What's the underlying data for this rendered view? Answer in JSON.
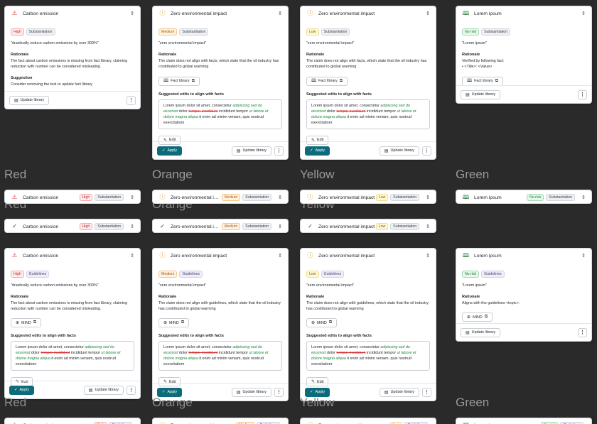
{
  "colors": {
    "red": "#c62828",
    "orange": "#e59a2f",
    "yellow": "#c9a20c",
    "green": "#217a3b",
    "apply": "#0d6c7b",
    "bg": "#2a2a2a"
  },
  "icons": {
    "red": "warning-triangle-icon",
    "orange": "info-circle-icon",
    "yellow": "info-circle-icon",
    "green": "book-icon",
    "check": "check-icon",
    "chevron": "chevron-updown-icon",
    "kebab": "kebab-icon",
    "library": "library-icon",
    "external": "external-link-icon",
    "globe": "globe-icon",
    "pencil": "pencil-icon"
  },
  "section_labels": {
    "red": "Red",
    "orange": "Orange",
    "yellow": "Yellow",
    "green": "Green"
  },
  "titles": {
    "red": "Carbon emission",
    "orange": "Zero environmental impact",
    "orange_short": "Zero environmental im...",
    "yellow": "Zero environmental impact",
    "green": "Lorem ipsum"
  },
  "severity": {
    "red": "High",
    "orange": "Medium",
    "yellow": "Low",
    "green": "No risk"
  },
  "categories": {
    "sub": "Substantiation",
    "guide": "Guidelines"
  },
  "quotes": {
    "red": "\"drastically reduce carbon emissions by over 300%\"",
    "orange": "\"zero environmental impact\"",
    "green": "\"Lorem ipsum\""
  },
  "labels": {
    "rationale": "Rationale",
    "suggestion": "Suggestion",
    "suggested": "Suggested edits to align with facts"
  },
  "rationale": {
    "red_fact": "The fact about carbon emissions is missing from fact library, claiming reduction with number can be considered misleading",
    "red_guide": "The fact about carbon emissions is missing from fact library, claiming reduction with number can be considered misleading.",
    "oy_fact": "The claim does not align with facts, which state that the oil industry has contributed to global warming",
    "oy_guide": "The claim does not align with guidelines, which state that the oil industry has contributed to global warming",
    "green_fact": "Verified by following fact:",
    "green_fact_item": "<Title>: <Value>",
    "green_guide": "Aligns with the guidelines <topic>."
  },
  "suggestion_text": "Consider removing the text or update fact library",
  "edit": {
    "p1": "Lorem ipsum dolor sit amet, consectetur ",
    "ins1": "adipiscing sed do eiusmod",
    "p2": " dolor ",
    "del1": "tempor incididunt",
    "p3": " incididunt tempor ",
    "ins2": "ut labore et dolore magna aliqua",
    "p4": " it enim ad minim veniam, quis nostrud exercitationr"
  },
  "buttons": {
    "fact": "Fact library",
    "mind": "MIND",
    "update": "Update library",
    "apply": "Apply",
    "edit": "Edit"
  }
}
